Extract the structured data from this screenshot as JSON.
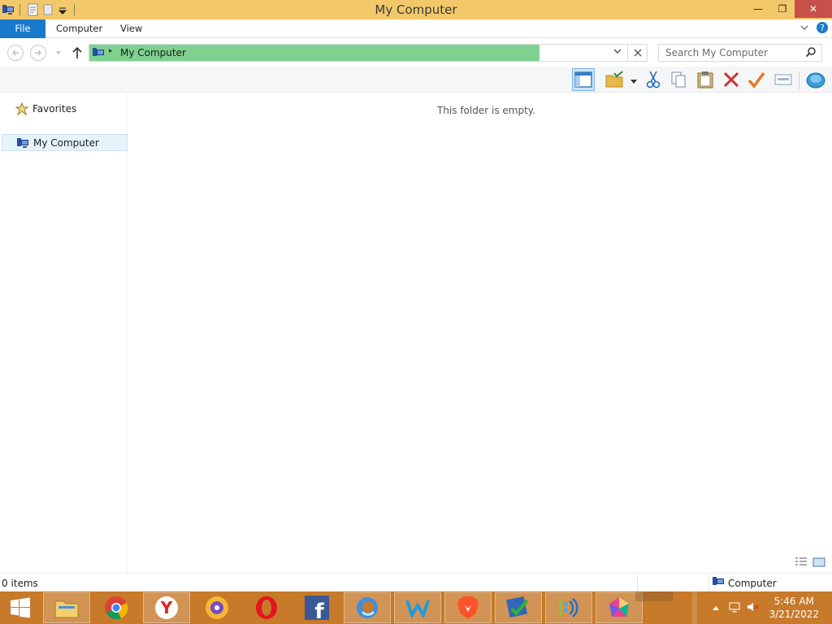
{
  "window": {
    "title": "My Computer",
    "controls": {
      "minimize": "—",
      "restore": "❐",
      "close": "✕"
    }
  },
  "ribbon": {
    "tabs": [
      {
        "label": "File"
      },
      {
        "label": "Computer"
      },
      {
        "label": "View"
      }
    ]
  },
  "address": {
    "location": "My Computer",
    "search_placeholder": "Search My Computer"
  },
  "toolbar": {
    "buttons": [
      "preview-pane",
      "folder-options",
      "cut",
      "copy",
      "paste",
      "delete",
      "check",
      "rename",
      "network"
    ]
  },
  "navigation": {
    "items": [
      {
        "label": "Favorites"
      },
      {
        "label": "My Computer"
      }
    ]
  },
  "content": {
    "empty_message": "This folder is empty."
  },
  "status": {
    "items_count": "0 items",
    "location_label": "Computer"
  },
  "taskbar": {
    "apps": [
      "start",
      "file-explorer",
      "chrome",
      "yandex",
      "cent-browser",
      "opera",
      "facebook",
      "edge",
      "wavebox",
      "brave",
      "app-checker",
      "dots-app",
      "color-app"
    ],
    "clock": {
      "time": "5:46 AM",
      "date": "3/21/2022"
    }
  },
  "colors": {
    "titlebar": "#f2c86a",
    "file_tab": "#1979ca",
    "address_highlight": "#7fd18f",
    "taskbar": "#c67a2a"
  }
}
